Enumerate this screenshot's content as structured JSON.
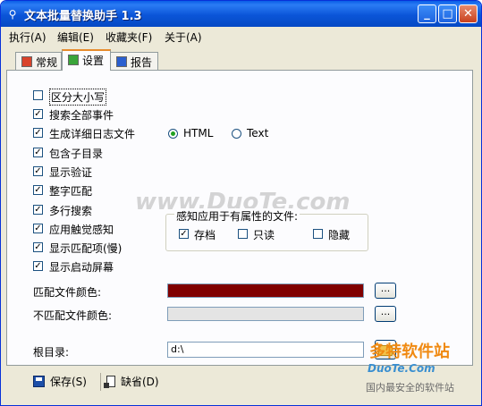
{
  "window": {
    "title": "文本批量替换助手  1.3",
    "minimize": "_",
    "maximize": "□",
    "close": "✕"
  },
  "menu": [
    "执行(A)",
    "编辑(E)",
    "收藏夹(F)",
    "关于(A)"
  ],
  "tabs": [
    {
      "label": "常规",
      "icon_color": "#d9432b"
    },
    {
      "label": "设置",
      "icon_color": "#3aa53a"
    },
    {
      "label": "报告",
      "icon_color": "#2b5fcf"
    }
  ],
  "active_tab": "设置",
  "options": [
    {
      "label": "区分大小写",
      "checked": false
    },
    {
      "label": "搜索全部事件",
      "checked": true
    },
    {
      "label": "生成详细日志文件",
      "checked": true
    },
    {
      "label": "包含子目录",
      "checked": true
    },
    {
      "label": "显示验证",
      "checked": true
    },
    {
      "label": "整字匹配",
      "checked": true
    },
    {
      "label": "多行搜索",
      "checked": true
    },
    {
      "label": "应用触觉感知",
      "checked": true
    },
    {
      "label": "显示匹配项(慢)",
      "checked": true
    },
    {
      "label": "显示启动屏幕",
      "checked": true
    }
  ],
  "log_format": {
    "html_label": "HTML",
    "text_label": "Text",
    "selected": "HTML"
  },
  "attributes": {
    "title": "感知应用于有属性的文件:",
    "archive": {
      "label": "存档",
      "checked": true
    },
    "readonly": {
      "label": "只读",
      "checked": false
    },
    "hidden": {
      "label": "隐藏",
      "checked": false
    }
  },
  "match_color": {
    "label": "匹配文件颜色:",
    "color": "#800000",
    "button": "..."
  },
  "nomatch_color": {
    "label": "不匹配文件颜色:",
    "color": "#e4e4e4",
    "button": "..."
  },
  "root_dir": {
    "label": "根目录:",
    "value": "d:\\"
  },
  "buttons": {
    "save": "保存(S)",
    "default": "缺省(D)"
  },
  "watermark": {
    "center": "www.DuoTe.com",
    "logo": "多特软件站",
    "logo_url": "DuoTe.Com",
    "slogan": "国内最安全的软件站"
  }
}
